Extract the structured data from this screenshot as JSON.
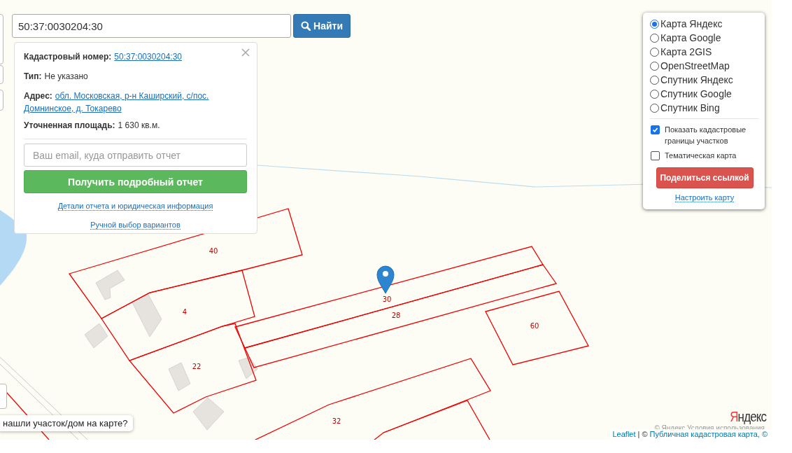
{
  "search": {
    "value": "50:37:0030204:30",
    "button": "Найти"
  },
  "info_popup": {
    "fields": [
      {
        "label": "Кадастровый номер:",
        "value": "50:37:0030204:30",
        "kind": "link"
      },
      {
        "label": "Тип:",
        "value": "Не указано",
        "kind": "text"
      },
      {
        "label": "Адрес:",
        "value": "обл. Московская, р-н Каширский, с/пос. Домнинское, д. Токарево",
        "kind": "link"
      },
      {
        "label": "Уточненная площадь:",
        "value": "1 630 кв.м.",
        "kind": "text"
      }
    ],
    "email_placeholder": "Ваш email, куда отправить отчет",
    "report_button": "Получить подробный отчет",
    "links": [
      "Детали отчета и юридическая информация",
      "Ручной выбор вариантов"
    ]
  },
  "layer_panel": {
    "base_layers": [
      {
        "label": "Карта Яндекс",
        "selected": true
      },
      {
        "label": "Карта Google",
        "selected": false
      },
      {
        "label": "Карта 2GIS",
        "selected": false
      },
      {
        "label": "OpenStreetMap",
        "selected": false
      },
      {
        "label": "Спутник Яндекс",
        "selected": false
      },
      {
        "label": "Спутник Google",
        "selected": false
      },
      {
        "label": "Спутник Bing",
        "selected": false
      }
    ],
    "overlays": [
      {
        "label": "Показать кадастровые границы участков",
        "checked": true
      },
      {
        "label": "Тематическая карта",
        "checked": false
      }
    ],
    "share_button": "Поделиться ссылкой",
    "settings_link": "Настроить карту"
  },
  "map": {
    "parcel_labels": [
      "40",
      "4",
      "22",
      "30",
      "28",
      "60",
      "32"
    ],
    "hint": "нашли участок/дом на карте?",
    "yandex_logo": "Яндекс",
    "yandex_terms": "© Яндекс  Условия использования",
    "attribution": {
      "link": "Leaflet",
      "separator": "| ©",
      "source": "Публичная кадастровая карта, ©"
    }
  }
}
